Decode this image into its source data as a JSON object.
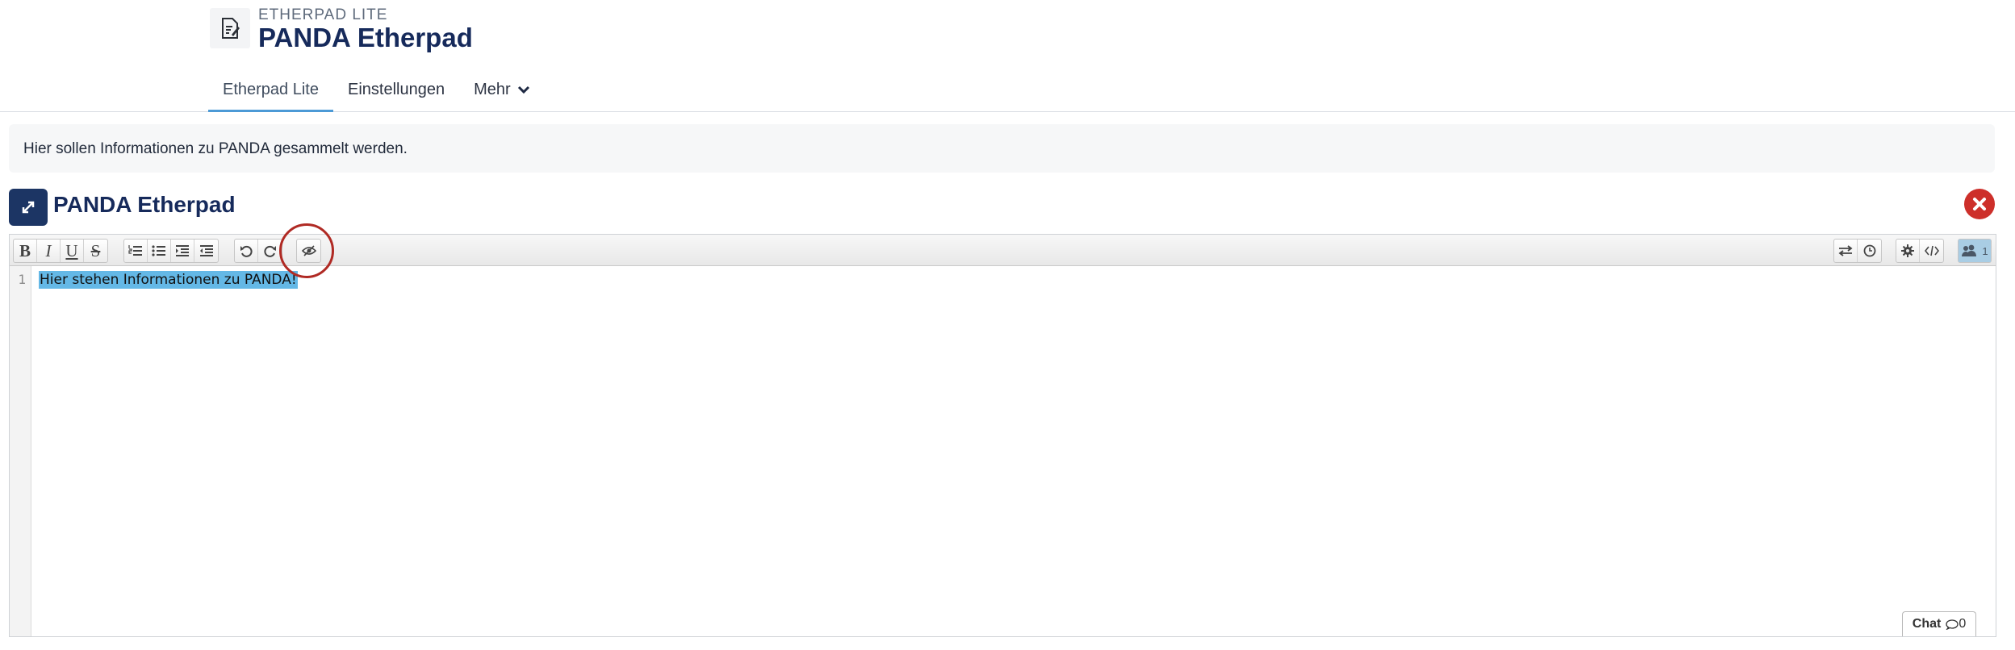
{
  "header": {
    "type_label": "ETHERPAD LITE",
    "title": "PANDA Etherpad",
    "icon": "etherpad-document-icon"
  },
  "tabs": [
    {
      "label": "Etherpad Lite",
      "active": true
    },
    {
      "label": "Einstellungen",
      "active": false
    },
    {
      "label": "Mehr",
      "active": false,
      "icon": "chevron-down-icon"
    }
  ],
  "info": {
    "text": "Hier sollen Informationen zu PANDA gesammelt werden."
  },
  "block": {
    "title": "PANDA Etherpad",
    "expand_icon": "expand-arrows-icon",
    "close_icon": "close-circle-icon"
  },
  "toolbar": {
    "format": {
      "bold": "B",
      "italic": "I",
      "underline": "U",
      "strikethrough": "S"
    },
    "list_icons": [
      "ordered-list-icon",
      "unordered-list-icon",
      "indent-icon",
      "outdent-icon"
    ],
    "history_icons": [
      "undo-icon",
      "redo-icon"
    ],
    "highlighted_icon": "clear-authorship-icon",
    "right_icons": [
      "import-export-icon",
      "timeslider-icon",
      "settings-icon",
      "embed-icon",
      "users-icon"
    ],
    "user_count": "1"
  },
  "editor": {
    "line_number": "1",
    "text": "Hier stehen Informationen zu PANDA!"
  },
  "chat": {
    "label": "Chat",
    "count": "0"
  },
  "colors": {
    "primary": "#1c3564",
    "tab_active": "#4c9ad6",
    "close": "#cd2f2a",
    "highlight_circle": "#b02a24",
    "selection": "#64b8e6"
  }
}
